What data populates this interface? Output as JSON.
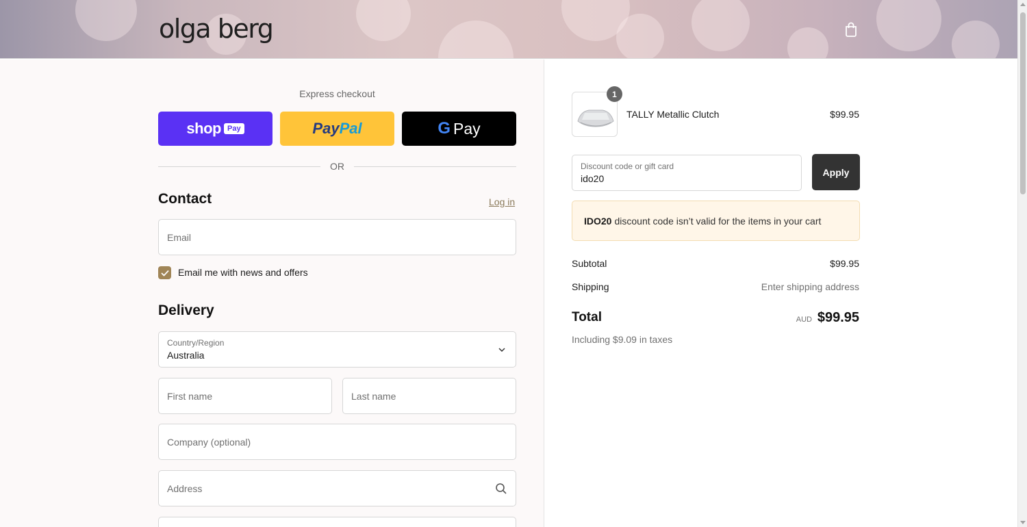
{
  "header": {
    "logo_text": "olga berg",
    "cart_icon": "shopping-bag-icon"
  },
  "express": {
    "label": "Express checkout",
    "shop_pay": {
      "brand": "shop",
      "pay": "Pay",
      "color": "#5a31f4"
    },
    "paypal": {
      "part1": "Pay",
      "part2": "Pal",
      "color": "#ffc439"
    },
    "google_pay": {
      "g": "G",
      "text": "Pay",
      "color": "#000000"
    },
    "or_label": "OR"
  },
  "contact": {
    "title": "Contact",
    "login_label": "Log in",
    "email_placeholder": "Email",
    "newsletter_label": "Email me with news and offers",
    "newsletter_checked": true
  },
  "delivery": {
    "title": "Delivery",
    "country_label": "Country/Region",
    "country_value": "Australia",
    "first_name_placeholder": "First name",
    "last_name_placeholder": "Last name",
    "company_placeholder": "Company (optional)",
    "address_placeholder": "Address"
  },
  "summary": {
    "item": {
      "name": "TALLY Metallic Clutch",
      "price": "$99.95",
      "quantity": "1"
    },
    "discount": {
      "label": "Discount code or gift card",
      "value": "ido20",
      "apply_label": "Apply"
    },
    "warning": {
      "code": "IDO20",
      "message": "discount code isn’t valid for the items in your cart"
    },
    "subtotal_label": "Subtotal",
    "subtotal_value": "$99.95",
    "shipping_label": "Shipping",
    "shipping_value": "Enter shipping address",
    "total_label": "Total",
    "total_currency": "AUD",
    "total_value": "$99.95",
    "tax_note": "Including $9.09 in taxes"
  },
  "colors": {
    "accent_checkbox": "#a08557",
    "warning_bg": "#fff6e8",
    "apply_bg": "#333333"
  }
}
